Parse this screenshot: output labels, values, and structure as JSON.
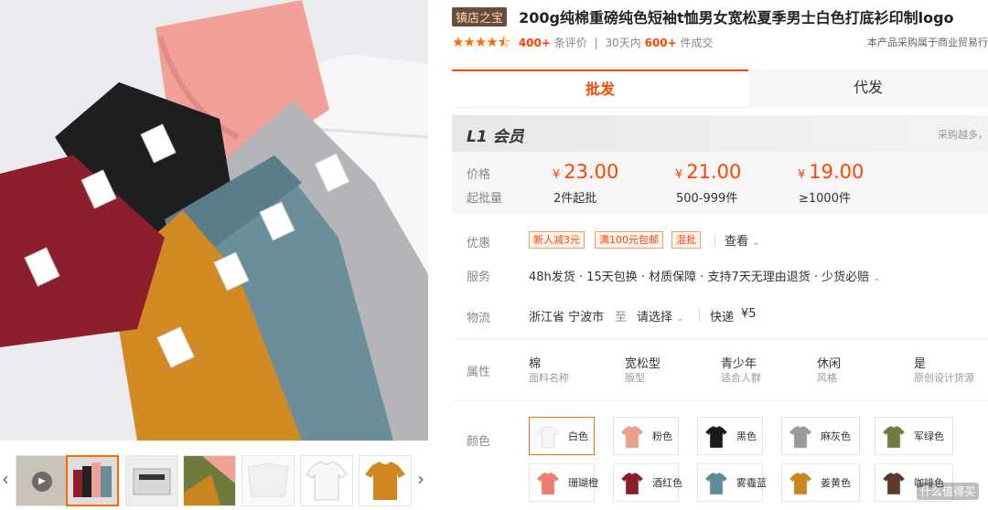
{
  "gallery": {
    "prev_arrow": "‹",
    "next_arrow": "›",
    "thumbs": [
      "video",
      "folded-shirts",
      "boxed",
      "green-shirt",
      "white-pair",
      "white-tee",
      "orange-tee"
    ]
  },
  "product": {
    "shop_badge": "镇店之宝",
    "title": "200g纯棉重磅纯色短袖t恤男女宽松夏季男士白色打底衫印制logo",
    "reviews_count": "400+",
    "reviews_label": "条评价",
    "sales_period": "30天内",
    "sales_count": "600+",
    "sales_label": "件成交",
    "notice": "本产品采购属于商业贸易行"
  },
  "tabs": {
    "wholesale": "批发",
    "dropship": "代发"
  },
  "pricing": {
    "member": "L1 会员",
    "member_tip": "采购越多，",
    "price_label": "价格",
    "moq_label": "起批量",
    "currency": "¥",
    "tiers": [
      {
        "price": "23.00",
        "moq": "2件起批"
      },
      {
        "price": "21.00",
        "moq": "500-999件"
      },
      {
        "price": "19.00",
        "moq": "≥1000件"
      }
    ]
  },
  "offers": {
    "label": "优惠",
    "coupons": [
      "新人减3元",
      "满100元包邮",
      "混批"
    ],
    "view": "查看"
  },
  "service": {
    "label": "服务",
    "text": "48h发货 · 15天包换 · 材质保障 · 支持7天无理由退货 · 少货必赔"
  },
  "logistics": {
    "label": "物流",
    "origin": "浙江省 宁波市",
    "to": "至",
    "destination": "请选择",
    "carrier": "快递",
    "fee": "¥5"
  },
  "attributes": {
    "label": "属性",
    "items": [
      {
        "value": "棉",
        "key": "面料名称"
      },
      {
        "value": "宽松型",
        "key": "版型"
      },
      {
        "value": "青少年",
        "key": "适合人群"
      },
      {
        "value": "休闲",
        "key": "风格"
      },
      {
        "value": "是",
        "key": "原创设计货源"
      }
    ]
  },
  "colors": {
    "label": "颜色",
    "options": [
      {
        "name": "白色",
        "hex": "#f5f5f5"
      },
      {
        "name": "粉色",
        "hex": "#eba08e"
      },
      {
        "name": "黑色",
        "hex": "#1a1a1a"
      },
      {
        "name": "麻灰色",
        "hex": "#9a9a9a"
      },
      {
        "name": "军绿色",
        "hex": "#6e7b3c"
      },
      {
        "name": "珊瑚橙",
        "hex": "#ee7d6e"
      },
      {
        "name": "酒红色",
        "hex": "#8a1f2a"
      },
      {
        "name": "雾霾蓝",
        "hex": "#5f8c96"
      },
      {
        "name": "姜黄色",
        "hex": "#c9861e"
      },
      {
        "name": "咖啡色",
        "hex": "#5a3a2a"
      }
    ]
  },
  "watermark": "什么值得买"
}
